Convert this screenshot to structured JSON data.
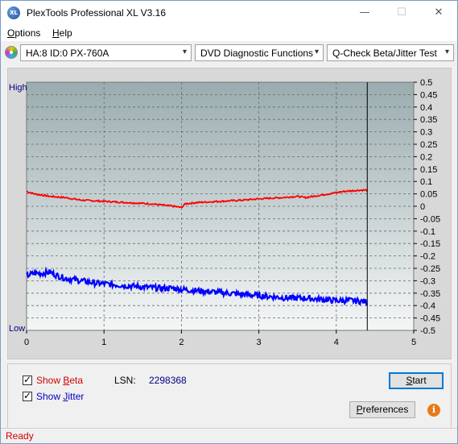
{
  "window": {
    "title": "PlexTools Professional XL V3.16",
    "icon_text": "XL"
  },
  "window_controls": {
    "minimize": "—",
    "maximize": "☐",
    "close": "✕"
  },
  "menu": {
    "items": [
      "Options",
      "Help"
    ]
  },
  "toolbar": {
    "drive": "HA:8 ID:0  PX-760A",
    "function": "DVD Diagnostic Functions",
    "test": "Q-Check Beta/Jitter Test",
    "drive_icon": "disc-icon",
    "dropdown_arrow": "▾"
  },
  "chart_data": {
    "type": "line",
    "y_left_labels": {
      "top": "High",
      "bottom": "Low"
    },
    "x_ticks": [
      "0",
      "1",
      "2",
      "3",
      "4",
      "5"
    ],
    "y_ticks": [
      "0.5",
      "0.45",
      "0.4",
      "0.35",
      "0.3",
      "0.25",
      "0.2",
      "0.15",
      "0.1",
      "0.05",
      "0",
      "-0.05",
      "-0.1",
      "-0.15",
      "-0.2",
      "-0.25",
      "-0.3",
      "-0.35",
      "-0.4",
      "-0.45",
      "-0.5"
    ],
    "xlim": [
      0,
      5
    ],
    "ylim": [
      -0.5,
      0.5
    ],
    "cursor_x": 4.4,
    "grid": true,
    "series": [
      {
        "name": "Beta",
        "color": "#ff0000",
        "x": [
          0,
          0.1,
          0.2,
          0.3,
          0.5,
          0.7,
          1.0,
          1.3,
          1.6,
          1.9,
          2.0,
          2.05,
          2.2,
          2.5,
          2.8,
          3.0,
          3.3,
          3.5,
          3.6,
          3.8,
          3.9,
          4.1,
          4.3,
          4.4
        ],
        "y": [
          0.06,
          0.05,
          0.045,
          0.04,
          0.035,
          0.025,
          0.02,
          0.015,
          0.01,
          0.0,
          -0.005,
          0.01,
          0.015,
          0.02,
          0.025,
          0.03,
          0.035,
          0.04,
          0.035,
          0.045,
          0.05,
          0.06,
          0.065,
          0.065
        ]
      },
      {
        "name": "Jitter",
        "color": "#0000ff",
        "x": [
          0,
          0.1,
          0.2,
          0.3,
          0.4,
          0.5,
          0.7,
          0.9,
          1.1,
          1.3,
          1.5,
          1.7,
          1.9,
          2.0,
          2.2,
          2.4,
          2.6,
          2.8,
          3.0,
          3.2,
          3.4,
          3.6,
          3.8,
          4.0,
          4.2,
          4.4
        ],
        "y": [
          -0.28,
          -0.27,
          -0.27,
          -0.265,
          -0.28,
          -0.29,
          -0.3,
          -0.31,
          -0.315,
          -0.32,
          -0.325,
          -0.33,
          -0.33,
          -0.335,
          -0.34,
          -0.345,
          -0.35,
          -0.355,
          -0.36,
          -0.365,
          -0.37,
          -0.37,
          -0.375,
          -0.38,
          -0.38,
          -0.385
        ]
      }
    ]
  },
  "bottom": {
    "show_beta_label": "Show Beta",
    "show_jitter_label": "Show Jitter",
    "lsn_label": "LSN:",
    "lsn_value": "2298368",
    "start_button": "Start",
    "preferences_button": "Preferences",
    "info_icon": "i"
  },
  "status": {
    "text": "Ready"
  },
  "colors": {
    "beta": "#ff0000",
    "jitter": "#0000ff",
    "status_text": "#d00000"
  }
}
